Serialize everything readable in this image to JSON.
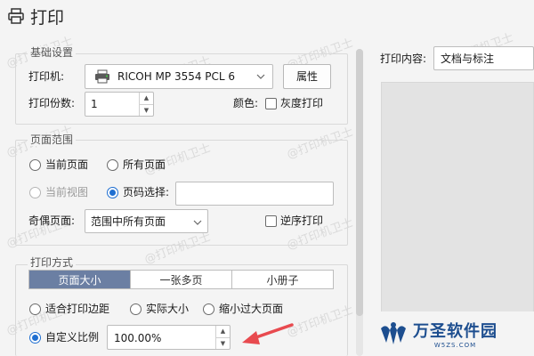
{
  "window": {
    "title": "打印",
    "icon": "printer-icon"
  },
  "basic": {
    "legend": "基础设置",
    "printer_label": "打印机:",
    "printer_value": "RICOH MP 3554 PCL 6",
    "properties_button": "属性",
    "copies_label": "打印份数:",
    "copies_value": "1",
    "color_label": "颜色:",
    "grayscale_label": "灰度打印"
  },
  "range": {
    "legend": "页面范围",
    "current_page": "当前页面",
    "all_pages": "所有页面",
    "current_view": "当前视图",
    "page_select": "页码选择:",
    "page_select_value": "",
    "odd_even_label": "奇偶页面:",
    "odd_even_value": "范围中所有页面",
    "reverse_label": "逆序打印"
  },
  "mode": {
    "legend": "打印方式",
    "tabs": [
      "页面大小",
      "一张多页",
      "小册子"
    ],
    "fit_margins": "适合打印边距",
    "actual_size": "实际大小",
    "shrink_large": "缩小过大页面",
    "custom_scale": "自定义比例",
    "scale_value": "100.00%"
  },
  "preview": {
    "content_label": "打印内容:",
    "content_value": "文档与标注"
  },
  "watermark": {
    "text": "@打印机卫士"
  },
  "logo": {
    "name": "万圣软件园",
    "domain": "W5ZS.COM"
  },
  "colors": {
    "accent": "#1f6fd1",
    "active_tab": "#6b7fa3",
    "arrow": "#e84a4f",
    "logo": "#1d4e8f"
  }
}
